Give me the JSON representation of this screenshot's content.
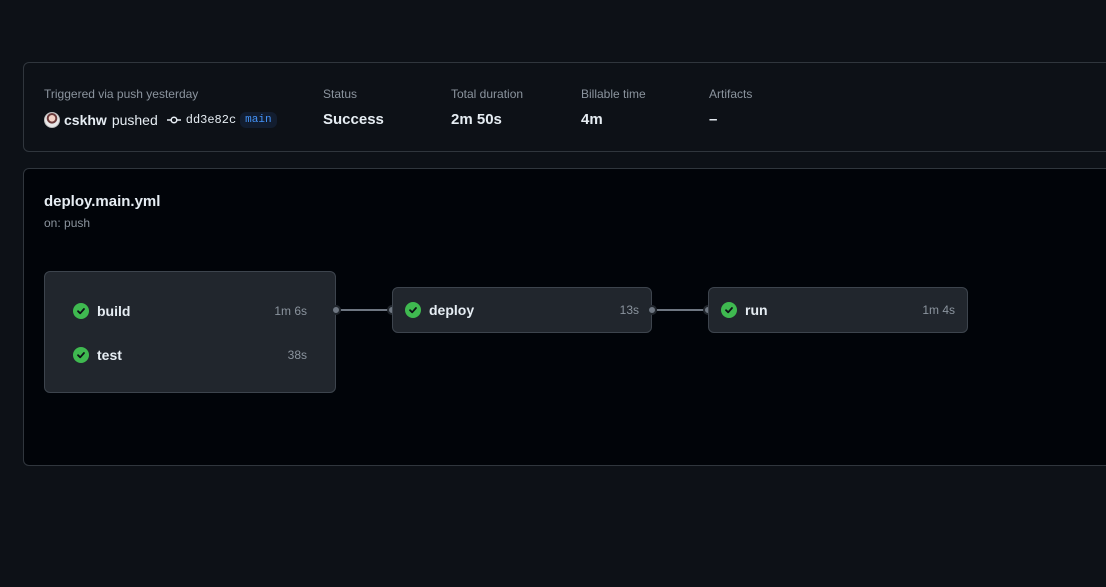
{
  "summary": {
    "trigger_label": "Triggered via push yesterday",
    "user": "cskhw",
    "action": "pushed",
    "commit_sha": "dd3e82c",
    "branch": "main",
    "status_label": "Status",
    "status_value": "Success",
    "duration_label": "Total duration",
    "duration_value": "2m 50s",
    "billable_label": "Billable time",
    "billable_value": "4m",
    "artifacts_label": "Artifacts",
    "artifacts_value": "–"
  },
  "workflow": {
    "file": "deploy.main.yml",
    "trigger": "on: push",
    "jobs": [
      {
        "name": "build",
        "duration": "1m 6s",
        "status": "success"
      },
      {
        "name": "test",
        "duration": "38s",
        "status": "success"
      },
      {
        "name": "deploy",
        "duration": "13s",
        "status": "success"
      },
      {
        "name": "run",
        "duration": "1m 4s",
        "status": "success"
      }
    ]
  },
  "colors": {
    "success": "#3fb950",
    "branch_text": "#4493f8",
    "background": "#0d1117"
  },
  "icons": {
    "check": "check-circle-icon",
    "commit": "git-commit-icon"
  }
}
